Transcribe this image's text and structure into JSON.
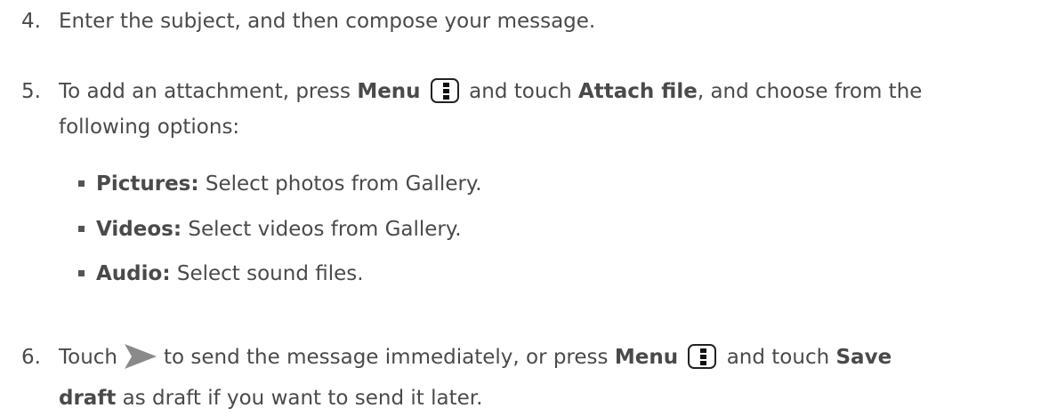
{
  "steps": [
    {
      "num": "4.",
      "text": "Enter the subject, and then compose your message."
    },
    {
      "num": "5.",
      "part1": "To add an attachment, press ",
      "menu": "Menu",
      "part2": " and touch ",
      "attach": "Attach file",
      "part3": ", and choose from the",
      "line2": "following options:"
    },
    {
      "num": "6.",
      "part1": "Touch",
      "part2": "to send the message immediately, or press ",
      "menu": "Menu",
      "part3": " and touch ",
      "save": "Save",
      "draft": "draft",
      "part4": " as draft if you want to send it later."
    }
  ],
  "options": [
    {
      "label": "Pictures:",
      "desc": " Select photos from Gallery."
    },
    {
      "label": "Videos:",
      "desc": " Select videos from Gallery."
    },
    {
      "label": "Audio:",
      "desc": " Select sound files."
    }
  ],
  "colors": {
    "text": "#4a4a4a",
    "send_icon": "#8a8a8a"
  },
  "icons": {
    "menu": "menu-key-icon",
    "send": "send-arrow-icon"
  }
}
